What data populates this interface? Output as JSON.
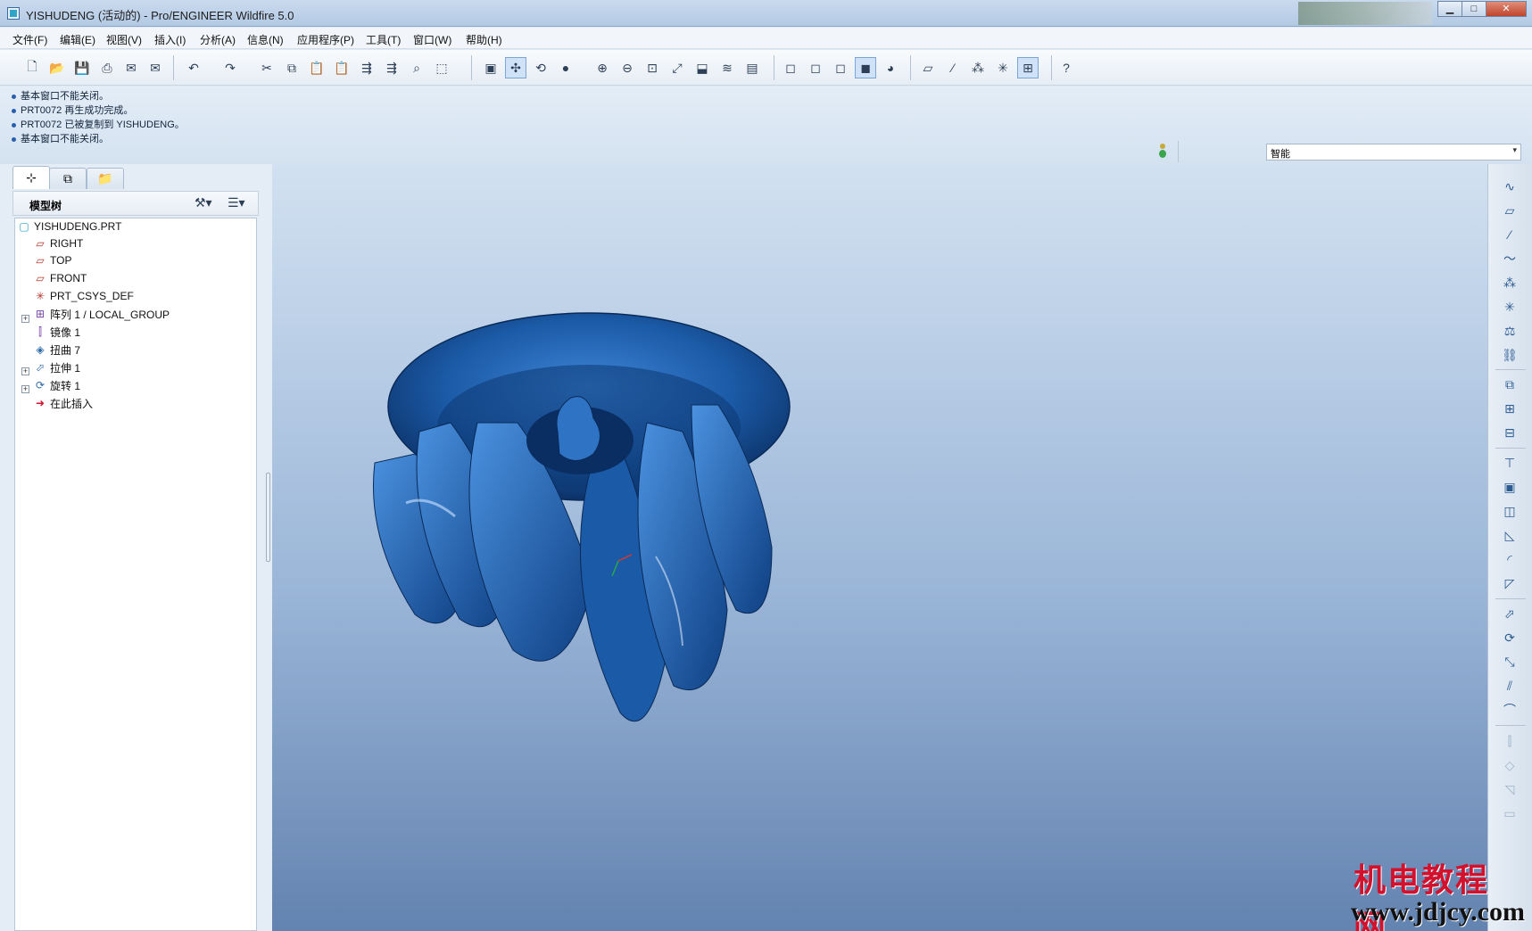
{
  "window": {
    "title": "YISHUDENG (活动的) - Pro/ENGINEER Wildfire 5.0",
    "minimize": "▁",
    "maximize": "□",
    "close": "✕"
  },
  "menu": [
    "文件(F)",
    "编辑(E)",
    "视图(V)",
    "插入(I)",
    "分析(A)",
    "信息(N)",
    "应用程序(P)",
    "工具(T)",
    "窗口(W)",
    "帮助(H)"
  ],
  "toolbar_icons": [
    "new-icon",
    "open-icon",
    "save-icon",
    "print-icon",
    "email-icon",
    "email-attach-icon",
    "undo-icon",
    "redo-icon",
    "cut-icon",
    "copy-icon",
    "paste-icon",
    "paste-special-icon",
    "regenerate-icon",
    "regen-manager-icon",
    "find-icon",
    "select-box-icon",
    "repaint-icon",
    "spin-center-icon",
    "orient-icon",
    "shading-icon",
    "zoom-in-icon",
    "zoom-out-icon",
    "refit-icon",
    "reorient-icon",
    "saved-views-icon",
    "layers-icon",
    "view-manager-icon",
    "wireframe-icon",
    "hidden-line-icon",
    "no-hidden-icon",
    "shaded-icon",
    "enhanced-realism-icon",
    "datum-planes-icon",
    "datum-axes-icon",
    "datum-points-icon",
    "csys-icon",
    "annotations-icon",
    "whats-this-icon"
  ],
  "messages": [
    "基本窗口不能关闭。",
    "PRT0072 再生成功完成。",
    "PRT0072 已被复制到 YISHUDENG。",
    "基本窗口不能关闭。"
  ],
  "filter": {
    "value": "智能"
  },
  "navigator": {
    "tabs": [
      "model-tree-tab",
      "folder-browser-tab",
      "favorites-tab"
    ],
    "tree_title": "模型树",
    "items": [
      {
        "label": "YISHUDENG.PRT",
        "icon": "part-icon",
        "expandable": false
      },
      {
        "label": "RIGHT",
        "icon": "datum-plane-icon",
        "expandable": false
      },
      {
        "label": "TOP",
        "icon": "datum-plane-icon",
        "expandable": false
      },
      {
        "label": "FRONT",
        "icon": "datum-plane-icon",
        "expandable": false
      },
      {
        "label": "PRT_CSYS_DEF",
        "icon": "csys-icon",
        "expandable": false
      },
      {
        "label": "阵列 1 / LOCAL_GROUP",
        "icon": "pattern-icon",
        "expandable": true
      },
      {
        "label": "镜像 1",
        "icon": "mirror-icon",
        "expandable": false
      },
      {
        "label": "扭曲 7",
        "icon": "warp-icon",
        "expandable": false
      },
      {
        "label": "拉伸 1",
        "icon": "extrude-icon",
        "expandable": true
      },
      {
        "label": "旋转 1",
        "icon": "revolve-icon",
        "expandable": true
      },
      {
        "label": "在此插入",
        "icon": "insert-here-icon",
        "expandable": false
      }
    ]
  },
  "model": {
    "color": "#1b5aa6"
  },
  "right_toolbar_icons": [
    "sketch-tool-icon",
    "plane-tool-icon",
    "axis-tool-icon",
    "curve-tool-icon",
    "point-tool-icon",
    "csys-tool-icon",
    "analysis-feature-icon",
    "datum-ref-icon",
    "copy-feature-icon",
    "mirror-feature-icon",
    "merge-feature-icon",
    "hole-tool-icon",
    "shell-tool-icon",
    "rib-tool-icon",
    "draft-tool-icon",
    "round-tool-icon",
    "chamfer-tool-icon",
    "extrude-tool-icon",
    "revolve-tool-icon",
    "sweep-tool-icon",
    "blend-tool-icon",
    "boundary-tool-icon",
    "pattern-tool-icon",
    "mirror-tool-icon",
    "trim-tool-icon",
    "offset-tool-icon"
  ],
  "watermark": {
    "cn": "机电教程网",
    "url": "www.jdjcy.com"
  }
}
